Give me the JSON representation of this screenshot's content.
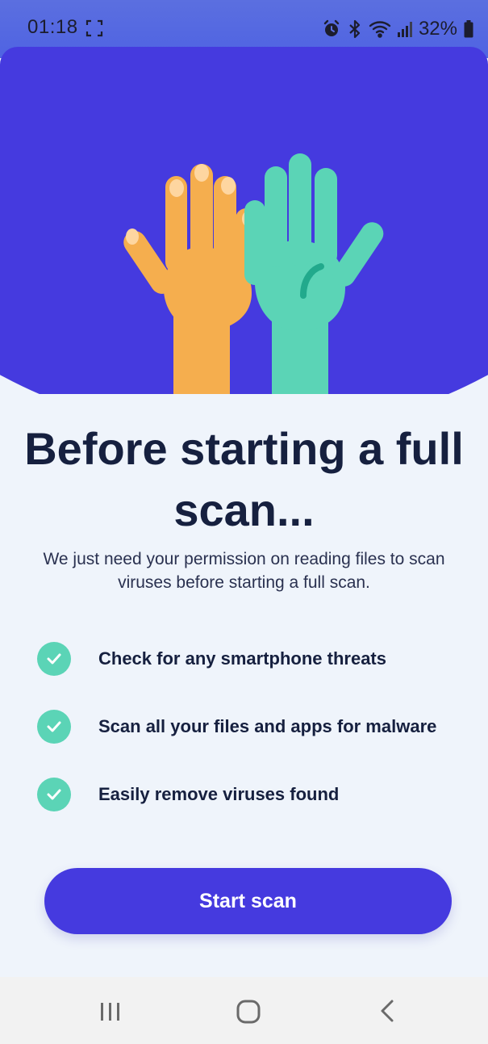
{
  "status_bar": {
    "time": "01:18",
    "battery_level": "32%",
    "icons": [
      "screenshot-icon",
      "alarm-icon",
      "bluetooth-icon",
      "wifi-icon",
      "cell-signal-icon",
      "battery-icon"
    ]
  },
  "hero": {
    "illustration": "two-raised-hands",
    "colors": {
      "background": "#453adf",
      "left_hand": "#f5ae4e",
      "right_hand": "#5bd4b6"
    }
  },
  "title": "Before starting a full scan...",
  "description": "We just need your permission on reading files to scan viruses before starting a full scan.",
  "features": [
    {
      "label": "Check for any smartphone threats",
      "icon": "check-icon"
    },
    {
      "label": "Scan all your files and apps for malware",
      "icon": "check-icon"
    },
    {
      "label": "Easily remove viruses found",
      "icon": "check-icon"
    }
  ],
  "primary_button": {
    "label": "Start scan",
    "color": "#453adf"
  },
  "nav_bar": {
    "buttons": [
      "recent-apps-icon",
      "home-icon",
      "back-icon"
    ]
  }
}
